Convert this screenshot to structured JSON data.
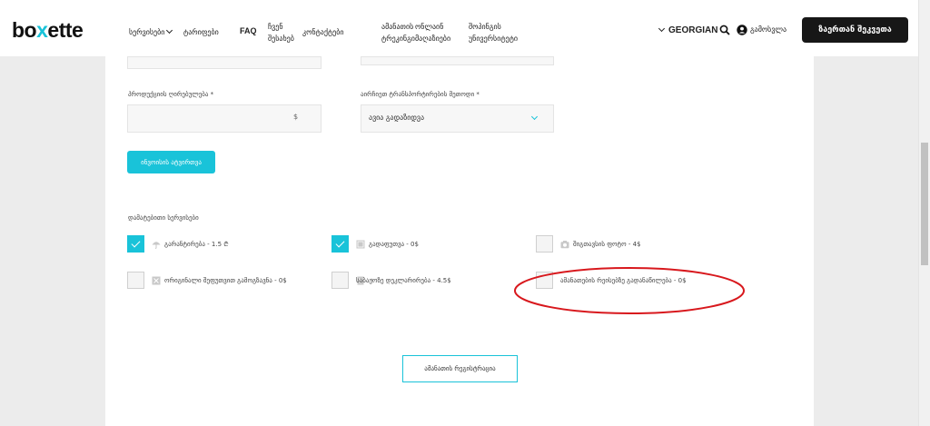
{
  "header": {
    "logo_prefix": "bo",
    "logo_x": "x",
    "logo_suffix": "ette",
    "nav": {
      "services": "სერვისები",
      "tariffs": "ტარიფები",
      "faq": "FAQ",
      "about_line1": "ჩვენ",
      "about_line2": "შესახებ",
      "contact": "კონტაქტები",
      "parcel_tracking_line1": "ამანათის",
      "parcel_tracking_line2": "ტრეკინგი",
      "online_stores_line1": "ონლაინ",
      "online_stores_line2": "მაღაზიები",
      "shopping_uni_line1": "შოპინგის",
      "shopping_uni_line2": "უნივერსიტეტი"
    },
    "language": "GEORGIAN",
    "login": "გამოსვლა",
    "contact_button": "ზაერთან შეკვეთა"
  },
  "form": {
    "product_value_label": "პროდუქციის ღირებულება *",
    "currency_symbol": "$",
    "transport_method_label": "აირჩიეთ ტრანსპორტირების მეთოდი *",
    "transport_method_value": "ავია გადაზიდვა",
    "invoice_button": "ინვოისის ატვირთვა",
    "additional_services_label": "დამატებითი სერვისები",
    "services": [
      {
        "label": "გარანტირება - 1.5 ₾",
        "checked": true,
        "icon": "umbrella-icon"
      },
      {
        "label": "გადაფუთვა - 0$",
        "checked": true,
        "icon": "box-icon"
      },
      {
        "label": "შიგთავსის ფოტო - 4$",
        "checked": false,
        "icon": "camera-icon"
      },
      {
        "label": "ორიგინალი შეფუთვით გამოგზავნა - 0$",
        "checked": false,
        "icon": "package-x-icon"
      },
      {
        "label": "საბაჟოზე დეკლარირება - 4.5$",
        "checked": false,
        "icon": "document-icon"
      },
      {
        "label": "ამანათების რეისებზე გადანაწილება - 0$",
        "checked": false,
        "icon": ""
      }
    ],
    "register_button": "ამანათის რეგისტრაცია"
  },
  "colors": {
    "accent": "#19c3d9",
    "dark_button": "#171717",
    "highlight_ellipse": "#d8181d"
  }
}
